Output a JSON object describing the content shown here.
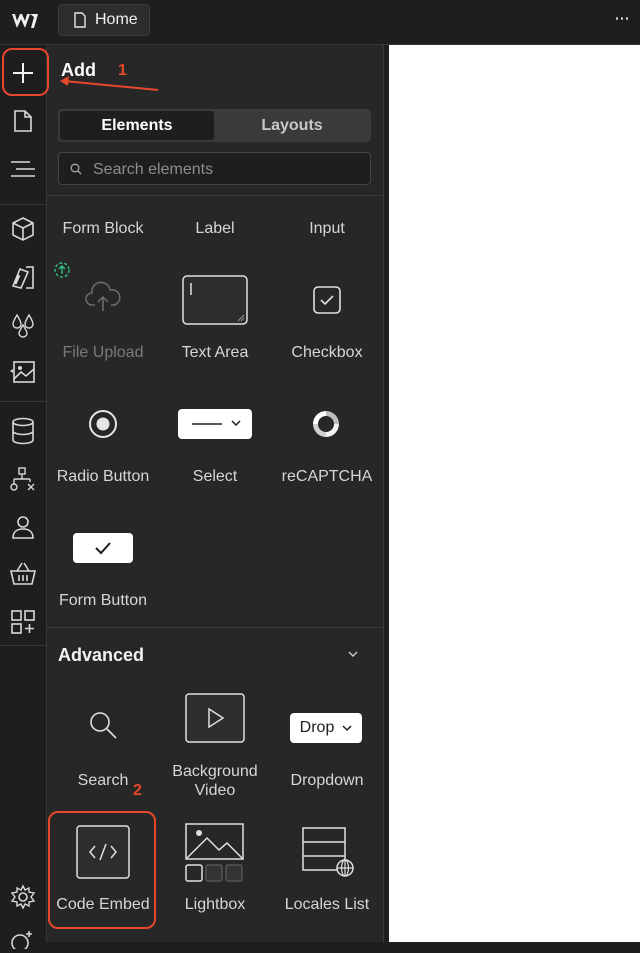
{
  "topbar": {
    "home_tab": "Home"
  },
  "panel": {
    "title": "Add",
    "tabs": [
      {
        "label": "Elements",
        "active": true
      },
      {
        "label": "Layouts",
        "active": false
      }
    ],
    "search": {
      "placeholder": "Search elements"
    },
    "forms": {
      "header_row": [
        "Form Block",
        "Label",
        "Input"
      ],
      "items": [
        {
          "label": "File Upload",
          "icon": "cloud-upload-icon",
          "disabled": true
        },
        {
          "label": "Text Area",
          "icon": "text-area-icon"
        },
        {
          "label": "Checkbox",
          "icon": "checkbox-icon"
        },
        {
          "label": "Radio Button",
          "icon": "radio-button-icon"
        },
        {
          "label": "Select",
          "icon": "select-icon"
        },
        {
          "label": "reCAPTCHA",
          "icon": "recaptcha-icon"
        },
        {
          "label": "Form Button",
          "icon": "form-button-icon"
        }
      ]
    },
    "advanced": {
      "title": "Advanced",
      "items": [
        {
          "label": "Search",
          "icon": "search-icon"
        },
        {
          "label": "Background Video",
          "label_line1": "Background",
          "label_line2": "Video",
          "icon": "background-video-icon"
        },
        {
          "label": "Dropdown",
          "icon": "dropdown-icon",
          "pill_text": "Drop"
        },
        {
          "label": "Code Embed",
          "icon": "code-embed-icon"
        },
        {
          "label": "Lightbox",
          "icon": "lightbox-icon"
        },
        {
          "label": "Locales List",
          "icon": "locales-list-icon"
        }
      ]
    }
  },
  "annotations": {
    "step1": "1",
    "step2": "2",
    "color": "#e5482a"
  },
  "colors": {
    "accent_annotation": "#e5482a",
    "upload_badge": "#2ec27e"
  }
}
